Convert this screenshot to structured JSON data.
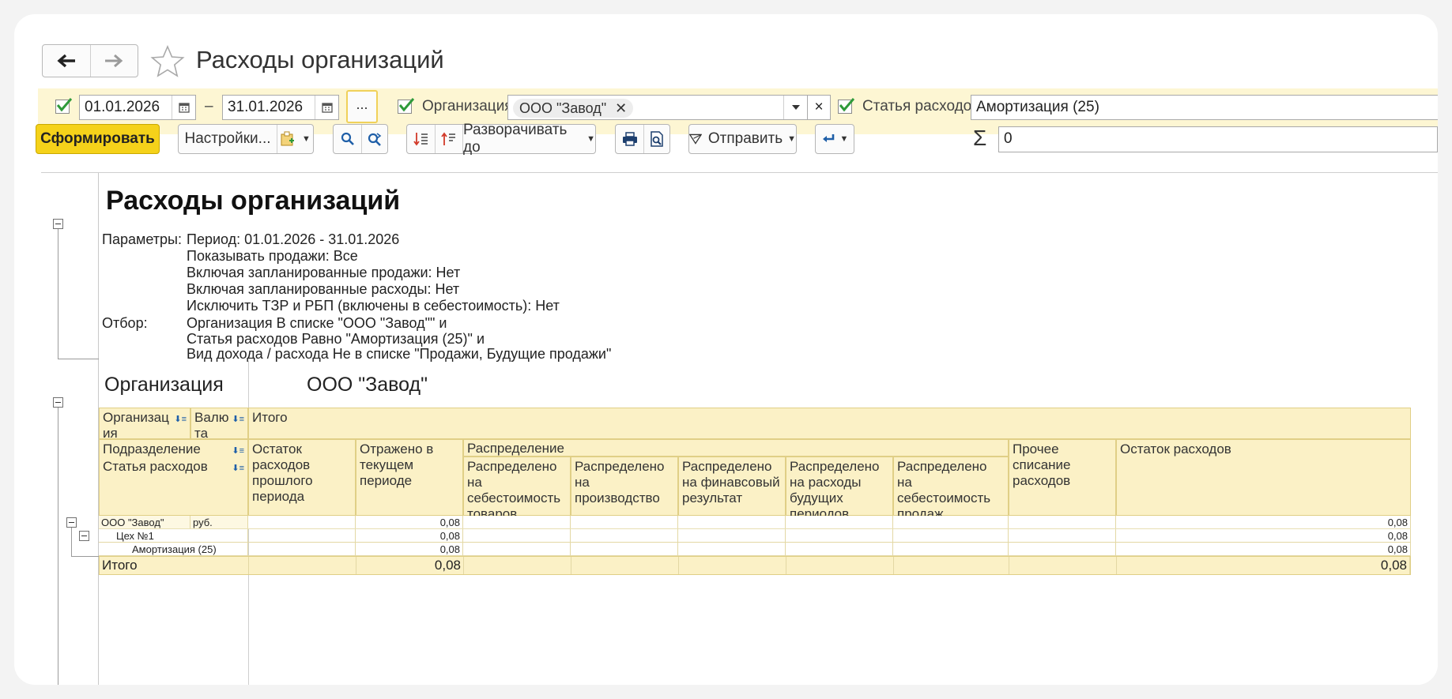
{
  "window": {
    "title": "Расходы организаций"
  },
  "filters": {
    "date_from": "01.01.2026",
    "date_to": "31.01.2026",
    "dash": "–",
    "more_label": "...",
    "org_label": "Организация:",
    "org_tag": "ООО \"Завод\"",
    "org_clear": "×",
    "cost_label": "Статья расходов:",
    "cost_value": "Амортизация (25)"
  },
  "toolbar": {
    "generate": "Сформировать",
    "settings": "Настройки...",
    "expand_to": "Разворачивать до",
    "send": "Отправить",
    "sigma": "Σ",
    "sum_value": "0"
  },
  "report": {
    "title": "Расходы организаций",
    "params_label": "Параметры:",
    "params": [
      "Период: 01.01.2026 - 31.01.2026",
      "Показывать продажи: Все",
      "Включая запланированные продажи: Нет",
      "Включая запланированные расходы: Нет",
      "Исключить ТЗР и РБП (включены в себестоимость): Нет"
    ],
    "filter_label": "Отбор:",
    "filters": [
      "Организация В списке \"ООО \"Завод\"\" и",
      "Статья расходов Равно \"Амортизация (25)\" и",
      "Вид дохода / расхода Не в списке \"Продажи, Будущие продажи\""
    ],
    "org_label": "Организация",
    "org_value": "ООО \"Завод\"",
    "headers": {
      "organization": "Организац ия",
      "currency": "Валю та",
      "total": "Итого",
      "department": "Подразделение",
      "cost_item": "Статья расходов",
      "opening": "Остаток расходов прошлого периода",
      "reflected": "Отражено в текущем периоде",
      "distribution": "Распределение",
      "dist_goods": "Распределено на себестоимость товаров",
      "dist_production": "Распределено на производство",
      "dist_fin": "Распределено на финавсовый результат",
      "dist_future": "Распределено на расходы будущих периодов",
      "dist_cost_sales": "Распределено на себестоимость продаж",
      "other_writeoff": "Прочее списание расходов",
      "closing": "Остаток расходов"
    },
    "rows": [
      {
        "name": "ООО \"Завод\"",
        "currency": "руб.",
        "reflected": "0,08",
        "closing": "0,08"
      },
      {
        "name": "Цех №1",
        "currency": "",
        "reflected": "0,08",
        "closing": "0,08"
      },
      {
        "name": "Амортизация (25)",
        "currency": "",
        "reflected": "0,08",
        "closing": "0,08"
      }
    ],
    "total_row": {
      "label": "Итого",
      "reflected": "0,08",
      "closing": "0,08"
    }
  }
}
